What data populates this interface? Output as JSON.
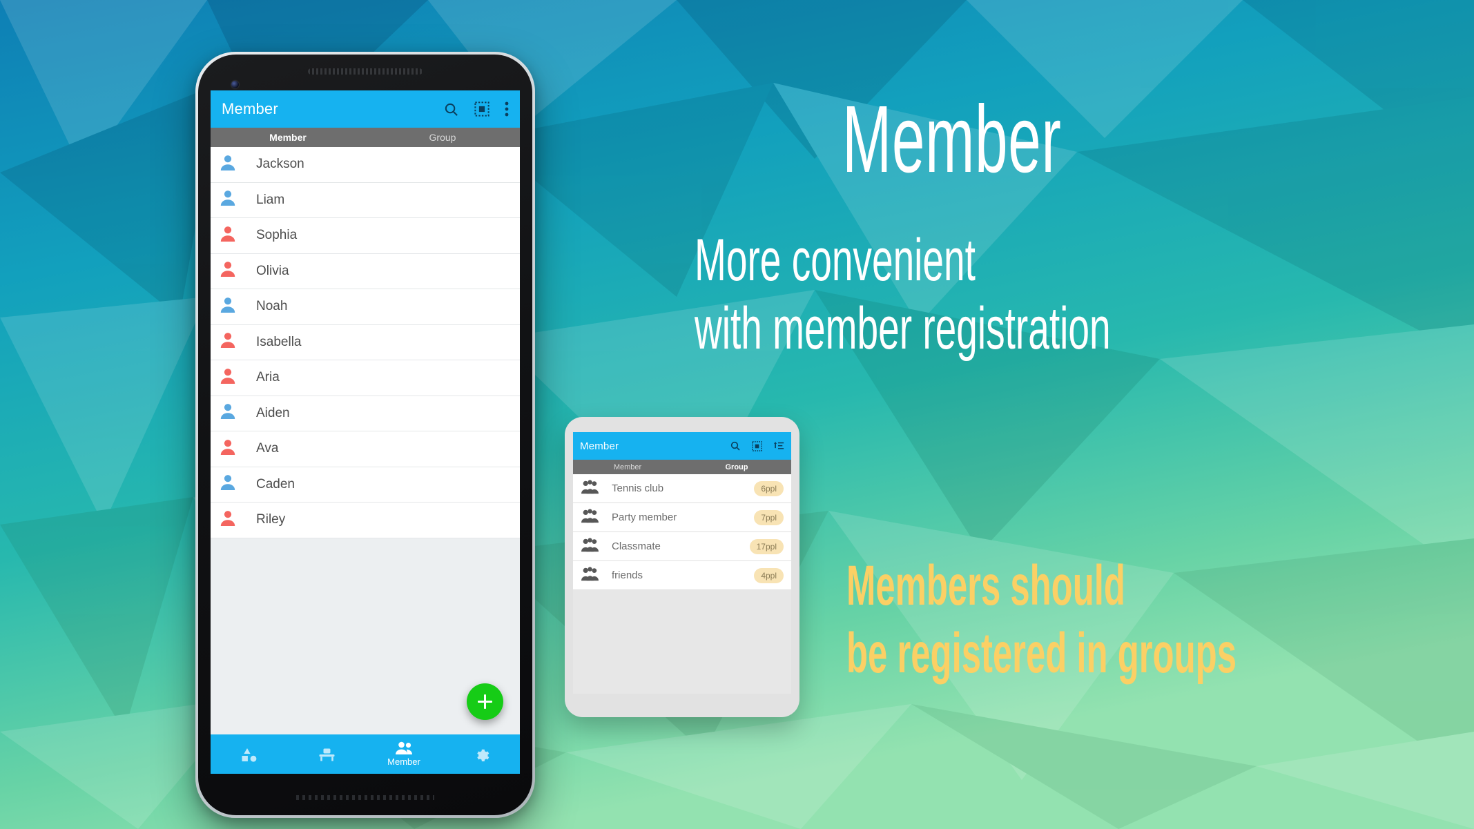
{
  "background": {
    "colors": [
      "#0e7fb5",
      "#12a3bd",
      "#25b7b0",
      "#5fd0a4",
      "#8fe0ae"
    ]
  },
  "marketing": {
    "headline": "Member",
    "subhead_line1": "More convenient",
    "subhead_line2": "with member registration",
    "gold_line1": "Members should",
    "gold_line2": "be registered in groups",
    "headline_color": "#ffffff",
    "gold_color": "#fbd065"
  },
  "phone_member": {
    "appbar": {
      "title": "Member",
      "actions": [
        "search-icon",
        "select-all-icon",
        "overflow-menu-icon"
      ]
    },
    "tabs": [
      {
        "label": "Member",
        "active": true
      },
      {
        "label": "Group",
        "active": false
      }
    ],
    "members": [
      {
        "name": "Jackson",
        "color": "#5aa8e0"
      },
      {
        "name": "Liam",
        "color": "#5aa8e0"
      },
      {
        "name": "Sophia",
        "color": "#f4655f"
      },
      {
        "name": "Olivia",
        "color": "#f4655f"
      },
      {
        "name": "Noah",
        "color": "#5aa8e0"
      },
      {
        "name": "Isabella",
        "color": "#f4655f"
      },
      {
        "name": "Aria",
        "color": "#f4655f"
      },
      {
        "name": "Aiden",
        "color": "#5aa8e0"
      },
      {
        "name": "Ava",
        "color": "#f4655f"
      },
      {
        "name": "Caden",
        "color": "#5aa8e0"
      },
      {
        "name": "Riley",
        "color": "#f4655f"
      }
    ],
    "fab": {
      "label": "+",
      "color": "#16cc16"
    },
    "bottom_nav": [
      {
        "icon": "shapes-icon",
        "label": "",
        "active": false
      },
      {
        "icon": "table-icon",
        "label": "",
        "active": false
      },
      {
        "icon": "members-icon",
        "label": "Member",
        "active": true
      },
      {
        "icon": "gear-icon",
        "label": "",
        "active": false
      }
    ]
  },
  "phone_group": {
    "appbar": {
      "title": "Member",
      "actions": [
        "search-icon",
        "select-all-icon",
        "sort-icon"
      ]
    },
    "tabs": [
      {
        "label": "Member",
        "active": false
      },
      {
        "label": "Group",
        "active": true
      }
    ],
    "groups": [
      {
        "name": "Tennis club",
        "count": "6ppl"
      },
      {
        "name": "Party member",
        "count": "7ppl"
      },
      {
        "name": "Classmate",
        "count": "17ppl"
      },
      {
        "name": "friends",
        "count": "4ppl"
      }
    ],
    "badge_color": "#f8e3b4"
  }
}
